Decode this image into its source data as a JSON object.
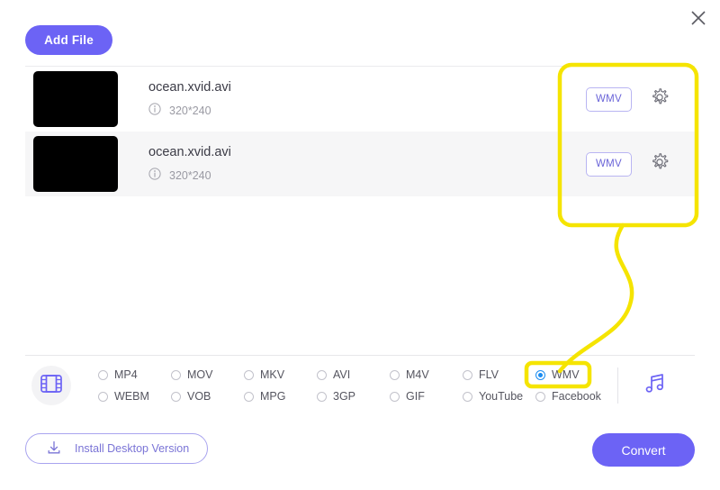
{
  "window": {
    "close_label": "×"
  },
  "toolbar": {
    "add_file_label": "Add File"
  },
  "files": [
    {
      "name": "ocean.xvid.avi",
      "resolution": "320*240",
      "target_format": "WMV"
    },
    {
      "name": "ocean.xvid.avi",
      "resolution": "320*240",
      "target_format": "WMV"
    }
  ],
  "format_bar": {
    "video_options_row1": [
      "MP4",
      "MOV",
      "MKV",
      "AVI",
      "M4V",
      "FLV",
      "WMV"
    ],
    "video_options_row2": [
      "WEBM",
      "VOB",
      "MPG",
      "3GP",
      "GIF",
      "YouTube",
      "Facebook"
    ],
    "selected_format": "WMV"
  },
  "footer": {
    "install_label": "Install Desktop Version",
    "convert_label": "Convert"
  },
  "icons": {
    "close": "close-icon",
    "info": "info-icon",
    "gear": "gear-icon",
    "film": "film-strip-icon",
    "music": "music-note-icon",
    "download": "download-icon"
  },
  "colors": {
    "accent": "#6c63f5",
    "highlight": "#f5e400",
    "radio_selected": "#1a8cf0",
    "row_alt_bg": "#f6f6f7"
  }
}
